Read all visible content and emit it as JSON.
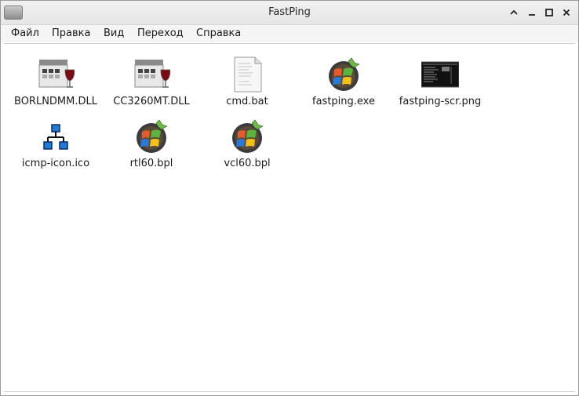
{
  "window": {
    "title": "FastPing",
    "controls": [
      "minimize",
      "restore",
      "maximize",
      "close"
    ]
  },
  "menubar": {
    "items": [
      "Файл",
      "Правка",
      "Вид",
      "Переход",
      "Справка"
    ]
  },
  "files": [
    {
      "name": "BORLNDMM.DLL",
      "icon": "wine-dll-icon"
    },
    {
      "name": "CC3260MT.DLL",
      "icon": "wine-dll-icon"
    },
    {
      "name": "cmd.bat",
      "icon": "text-file-icon"
    },
    {
      "name": "fastping.exe",
      "icon": "windows-exe-icon"
    },
    {
      "name": "fastping-scr.png",
      "icon": "image-thumbnail-icon"
    },
    {
      "name": "icmp-icon.ico",
      "icon": "network-icon"
    },
    {
      "name": "rtl60.bpl",
      "icon": "windows-exe-icon"
    },
    {
      "name": "vcl60.bpl",
      "icon": "windows-exe-icon"
    }
  ]
}
